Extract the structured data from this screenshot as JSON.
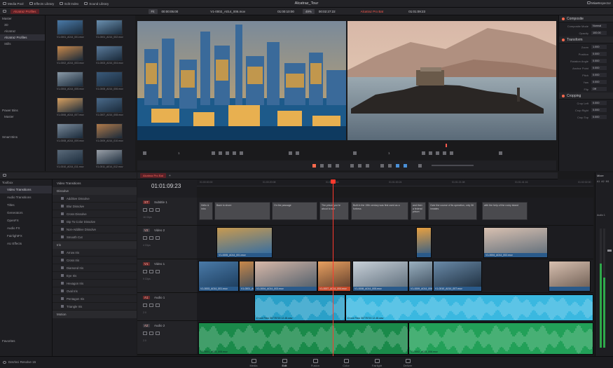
{
  "window": {
    "title": "Alcatraz_Tour",
    "tabs": [
      "Media Pool",
      "Effects Library",
      "Edit Index",
      "Sound Library"
    ],
    "mixer_label": "Mixer",
    "inspector_label": "Inspector"
  },
  "source_viewer": {
    "bin_pill": "Alcatraz Profiles",
    "zoom": "Fit",
    "duration": "00:00:05:00",
    "clip_name": "V1-0002_A014_006.mov",
    "timecode": "01:00:10:00"
  },
  "timeline_viewer": {
    "zoom": "49%",
    "duration": "00:02:27:22",
    "clip_name": "Alcatraz Pro Bat",
    "timecode": "01:01:09:23"
  },
  "media_pool": {
    "bins": [
      {
        "label": "Master",
        "selected": false
      },
      {
        "label": "3D",
        "selected": false
      },
      {
        "label": "Alcatraz",
        "selected": false
      },
      {
        "label": "Alcatraz Profiles",
        "selected": true
      },
      {
        "label": "Stills",
        "selected": false
      }
    ],
    "power_bins_label": "Power Bins",
    "power_bin_items": [
      "Master"
    ],
    "smart_bins_label": "Smart Bins",
    "clips": [
      "V1-0001_A014_001.mov",
      "V1-0001_A014_002.mov",
      "V1-0002_A014_003.mov",
      "V1-0003_A014_004.mov",
      "V1-0004_A014_005.mov",
      "V1-0005_A014_006.mov",
      "V1-0006_A014_007.mov",
      "V1-0007_A014_008.mov",
      "V1-0008_A014_009.mov",
      "V1-0009_A014_010.mov",
      "V1-0010_A014_011.mov",
      "V1-0011_A014_012.mov"
    ]
  },
  "viewer_controls": {
    "source_frame": "1",
    "timeline_frame": "1"
  },
  "inspector": {
    "composite_header": "Composite",
    "composite_rows": [
      {
        "label": "Composite Mode",
        "value": "Normal"
      },
      {
        "label": "Opacity",
        "value": "100.00"
      }
    ],
    "transform_header": "Transform",
    "transform_rows": [
      {
        "label": "Zoom",
        "value": "1.000"
      },
      {
        "label": "Position",
        "value": "0.000"
      },
      {
        "label": "Rotation Angle",
        "value": "0.000"
      },
      {
        "label": "Anchor Point",
        "value": "0.000"
      },
      {
        "label": "Pitch",
        "value": "0.000"
      },
      {
        "label": "Yaw",
        "value": "0.000"
      },
      {
        "label": "Flip",
        "value": "Off"
      }
    ],
    "cropping_header": "Cropping",
    "cropping_rows": [
      {
        "label": "Crop Left",
        "value": "0.000"
      },
      {
        "label": "Crop Right",
        "value": "0.000"
      },
      {
        "label": "Crop Top",
        "value": "0.000"
      }
    ]
  },
  "effects_library": {
    "tree_label": "Toolbox",
    "tree": [
      {
        "label": "Video Transitions",
        "selected": true
      },
      {
        "label": "Audio Transitions",
        "selected": false
      },
      {
        "label": "Titles",
        "selected": false
      },
      {
        "label": "Generators",
        "selected": false
      },
      {
        "label": "OpenFX",
        "selected": false
      },
      {
        "label": "Audio FX",
        "selected": false
      },
      {
        "label": "FairlightFX",
        "selected": false
      },
      {
        "label": "AU Effects",
        "selected": false
      }
    ],
    "favorites_label": "Favorites",
    "list_title": "Video Transitions",
    "group1": "Dissolve",
    "group1_items": [
      "Additive Dissolve",
      "Blur Dissolve",
      "Cross Dissolve",
      "Dip To Color Dissolve",
      "Non-Additive Dissolve",
      "Smooth Cut"
    ],
    "group2": "Iris",
    "group2_items": [
      "Arrow Iris",
      "Cross Iris",
      "Diamond Iris",
      "Eye Iris",
      "Hexagon Iris",
      "Oval Iris",
      "Pentagon Iris",
      "Triangle Iris"
    ],
    "group3": "Motion"
  },
  "timeline": {
    "tab": "Alcatraz Pro Bat",
    "timecode": "01:01:09:23",
    "ruler": [
      "01:00:00:00",
      "01:00:20:08",
      "01:00:40:16",
      "01:01:00:24",
      "01:01:21:08",
      "01:01:41:16",
      "01:02:02:00"
    ],
    "tracks": [
      {
        "badge": "ST",
        "name": "Subtitle 1",
        "info": "16 Clips"
      },
      {
        "badge": "V2",
        "name": "Video 2",
        "info": "4 Clips"
      },
      {
        "badge": "V1",
        "name": "Video 1",
        "info": "9 Clips"
      },
      {
        "badge": "A1",
        "name": "Audio 1",
        "info": "2.0"
      },
      {
        "badge": "A2",
        "name": "Audio 2",
        "info": "2.0"
      }
    ],
    "subtitles": [
      "Hello & intro",
      "Back to shore",
      "On the passage",
      "The prison you're about to see",
      "Built in the 19th century was first used as a fortress",
      "and then a federal prison",
      "Over the course of its operation, only 36 inmates",
      "with the help of the rocky island"
    ],
    "v2_clips": [
      "V1-0005_A014_001.mov",
      "V1-0004_A014_002.mov"
    ],
    "v1_clips": [
      "V1-0003_A014_001.mov",
      "V1-0001_A014_002.mov",
      "V1-0004_A014_003.mov",
      "V1-0007_A014_004.mov",
      "V1-0008_A014_005.mov",
      "V1-0009_A014_006.mov",
      "V1-0010_A014_007.mov"
    ],
    "a1_clips": [
      "Drone Flow 30778715 12.48.wav",
      "Drone Flow 30778715 12.48.wav"
    ],
    "a2_clips": [
      "V1-0001_A014_005.mov",
      "V1-0002_A014_006.mov"
    ]
  },
  "bottom": {
    "app": "DaVinci Resolve 15",
    "pages": [
      {
        "label": "Media",
        "selected": false
      },
      {
        "label": "Edit",
        "selected": true
      },
      {
        "label": "Fusion",
        "selected": false
      },
      {
        "label": "Color",
        "selected": false
      },
      {
        "label": "Fairlight",
        "selected": false
      },
      {
        "label": "Deliver",
        "selected": false
      }
    ]
  },
  "mixer": {
    "label": "Mixer",
    "channels": [
      "A1",
      "A2",
      "M1"
    ],
    "sub_label": "Audio 1"
  }
}
